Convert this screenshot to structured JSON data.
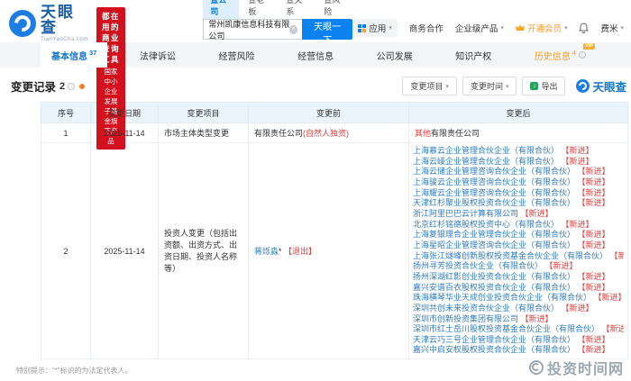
{
  "header": {
    "brand": "天眼查",
    "brand_domain": "TianYanCha.com",
    "banner_line1": "都在用的商业查询工具",
    "banner_line2": "国家中小企业发展子基金旗下产品",
    "search_tabs": [
      {
        "label": "查公司"
      },
      {
        "label": "查老板"
      },
      {
        "label": "查关系"
      },
      {
        "label": "查风险"
      }
    ],
    "search_value": "常州凯康信息科技有限公司",
    "search_button": "天眼一下",
    "menu": {
      "apps": "应用",
      "cooperation": "商务合作",
      "enterprise": "企业级产品",
      "vip": "开通会员",
      "user": "费米"
    }
  },
  "nav": {
    "tabs": [
      {
        "label": "基本信息",
        "count": "37"
      },
      {
        "label": "法律诉讼",
        "count": ""
      },
      {
        "label": "经营风险",
        "count": ""
      },
      {
        "label": "经营信息",
        "count": ""
      },
      {
        "label": "公司发展",
        "count": ""
      },
      {
        "label": "知识产权",
        "count": ""
      },
      {
        "label": "历史信息",
        "count": "4"
      }
    ]
  },
  "section": {
    "title": "变更记录",
    "count": "2",
    "filter_item": "变更项目",
    "filter_time": "变更时间",
    "export": "导出",
    "logo_text": "天眼查"
  },
  "table": {
    "headers": [
      "序号",
      "变更日期",
      "变更项目",
      "变更前",
      "变更后"
    ],
    "rows": [
      {
        "no": "1",
        "date": "2025-11-14",
        "item": "市场主体类型变更",
        "before_black": "有限责任公司",
        "before_red": "(自然人独资)",
        "after_red": "其他",
        "after_black": "有限责任公司"
      },
      {
        "no": "2",
        "date": "2025-11-14",
        "item": "投资人变更（包括出资额、出资方式、出资日期、投资人名称等）",
        "before_link": "蒋烁淼",
        "before_star": "*",
        "before_tag": "【退出】",
        "after_list": [
          {
            "name": "上海慕云企业管理合伙企业（有限合伙）",
            "tag": "【新进】"
          },
          {
            "name": "上海云崚企业管理合伙企业（有限合伙）",
            "tag": "【新进】"
          },
          {
            "name": "上海云储企业管理咨询合伙企业（有限合伙）",
            "tag": "【新进】"
          },
          {
            "name": "上海骏云企业管理咨询合伙企业（有限合伙）",
            "tag": "【新进】"
          },
          {
            "name": "上海耀云企业管理咨询合伙企业（有限合伙）",
            "tag": "【新进】"
          },
          {
            "name": "天津红杉聚业股权投资合伙企业（有限合伙）",
            "tag": "【新进】"
          },
          {
            "name": "浙江阿里巴巴云计算有限公司",
            "tag": "【新进】"
          },
          {
            "name": "北京红杉铭德股权投资中心（有限合伙）",
            "tag": "【新进】"
          },
          {
            "name": "上海复银理合企业管理合伙企业（有限合伙）",
            "tag": "【新进】"
          },
          {
            "name": "上海星昭企业管理咨询合伙企业（有限合伙）",
            "tag": "【新进】"
          },
          {
            "name": "上海张江燧峰创新股权投资基金合伙企业（有限合伙）",
            "tag": "【新进】"
          },
          {
            "name": "扬州寻芳投资合伙企业（有限合伙）",
            "tag": "【新进】"
          },
          {
            "name": "扬州深湖红影创业投资合伙企业（有限合伙）",
            "tag": "【新进】"
          },
          {
            "name": "嘉兴安谱百衣股权投资合伙企业（有限合伙）",
            "tag": "【新进】"
          },
          {
            "name": "珠海横琴华业天成创业投资合伙企业（有限合伙）",
            "tag": "【新进】"
          },
          {
            "name": "深圳共创未来投资合伙企业（有限合伙）",
            "tag": "【新进】"
          },
          {
            "name": "深圳市创新投资集团有限公司",
            "tag": "【新进】"
          },
          {
            "name": "深圳市红土岳川股权投资基金合伙企业（有限合伙）",
            "tag": "【新进】"
          },
          {
            "name": "天津云巧三号企业管理合伙企业（有限合伙）",
            "tag": "【新进】"
          },
          {
            "name": "嘉兴中启安权股权投资合伙企业（有限合伙）",
            "tag": "【新进】"
          }
        ]
      }
    ]
  },
  "footer": {
    "note": "特别提示：“*”标识的为法定代表人。",
    "watermark": "投资时间网"
  }
}
